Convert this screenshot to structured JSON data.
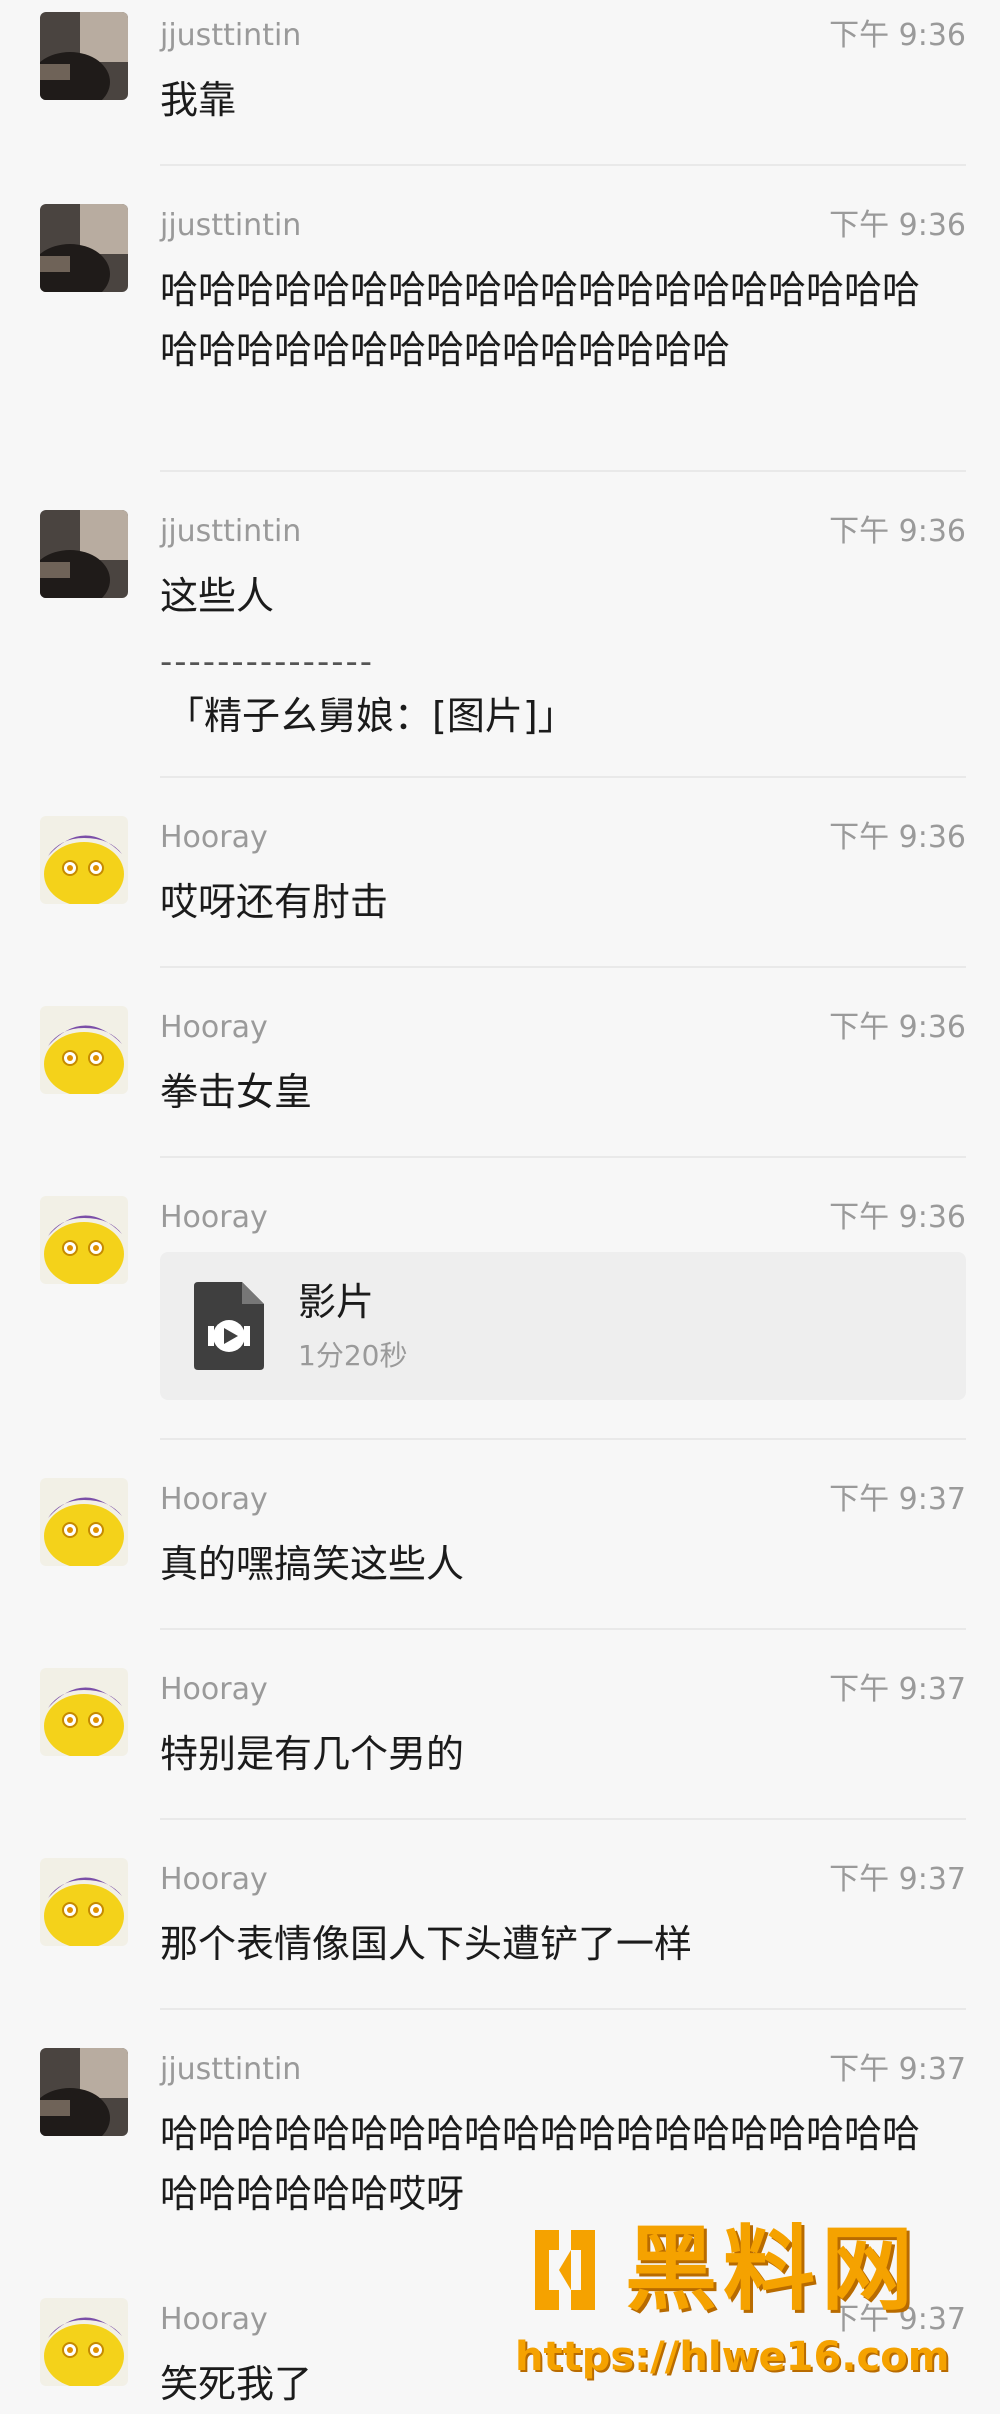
{
  "messages": [
    {
      "sender": "jjusttintin",
      "time": "下午 9:36",
      "text": "我靠"
    },
    {
      "sender": "jjusttintin",
      "time": "下午 9:36",
      "text": "哈哈哈哈哈哈哈哈哈哈哈哈哈哈哈哈哈哈哈哈哈哈哈哈哈哈哈哈哈哈哈哈哈哈哈"
    },
    {
      "sender": "jjusttintin",
      "time": "下午 9:36",
      "text": "这些人",
      "quote_rule": "---------------",
      "quote": "「精子幺舅娘：[图片]」"
    },
    {
      "sender": "Hooray",
      "time": "下午 9:36",
      "text": "哎呀还有肘击"
    },
    {
      "sender": "Hooray",
      "time": "下午 9:36",
      "text": "拳击女皇"
    },
    {
      "sender": "Hooray",
      "time": "下午 9:36",
      "file": {
        "name": "影片",
        "duration": "1分20秒",
        "icon": "video-file-icon"
      }
    },
    {
      "sender": "Hooray",
      "time": "下午 9:37",
      "text": "真的嘿搞笑这些人"
    },
    {
      "sender": "Hooray",
      "time": "下午 9:37",
      "text": "特别是有几个男的"
    },
    {
      "sender": "Hooray",
      "time": "下午 9:37",
      "text": "那个表情像国人下头遭铲了一样"
    },
    {
      "sender": "jjusttintin",
      "time": "下午 9:37",
      "text": "哈哈哈哈哈哈哈哈哈哈哈哈哈哈哈哈哈哈哈哈哈哈哈哈哈哈哎呀"
    },
    {
      "sender": "Hooray",
      "time": "下午 9:37",
      "text": "笑死我了"
    }
  ],
  "watermark": {
    "title": "黑料网",
    "url": "https://hlwe16.com"
  },
  "colors": {
    "background": "#f7f7f7",
    "meta": "#9a9a9a",
    "watermark": "#f5a200"
  }
}
